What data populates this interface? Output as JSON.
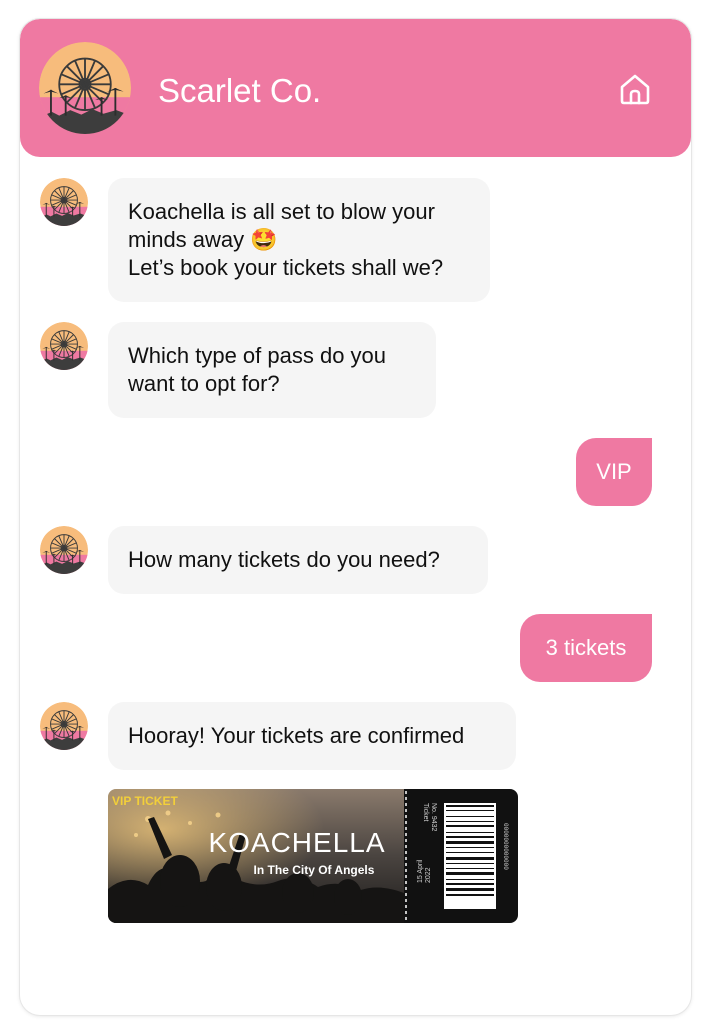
{
  "header": {
    "title": "Scarlet Co.",
    "home_icon": "home-icon"
  },
  "colors": {
    "accent": "#ef79a2",
    "bubble_in": "#f5f5f5",
    "ticket_badge": "#f2cf3a",
    "ticket_stub": "#111111"
  },
  "messages": [
    {
      "from": "bot",
      "lines": [
        "Koachella is all set to blow your",
        "minds away 🤩",
        "Let’s book your tickets shall we?"
      ]
    },
    {
      "from": "bot",
      "lines": [
        "Which type of pass do you",
        "want to opt for?"
      ]
    },
    {
      "from": "user",
      "text": "VIP"
    },
    {
      "from": "bot",
      "lines": [
        "How many tickets do you need?"
      ]
    },
    {
      "from": "user",
      "text": "3 tickets"
    },
    {
      "from": "bot",
      "lines": [
        "Hooray! Your tickets are confirmed"
      ]
    }
  ],
  "ticket": {
    "badge": "VIP TICKET",
    "title": "KOACHELLA",
    "subtitle": "In The City Of Angels",
    "stub_label": "Ticket",
    "stub_number": "No. 9432",
    "date": "15 April",
    "year": "2022",
    "barcode_number": "0000000000000"
  }
}
